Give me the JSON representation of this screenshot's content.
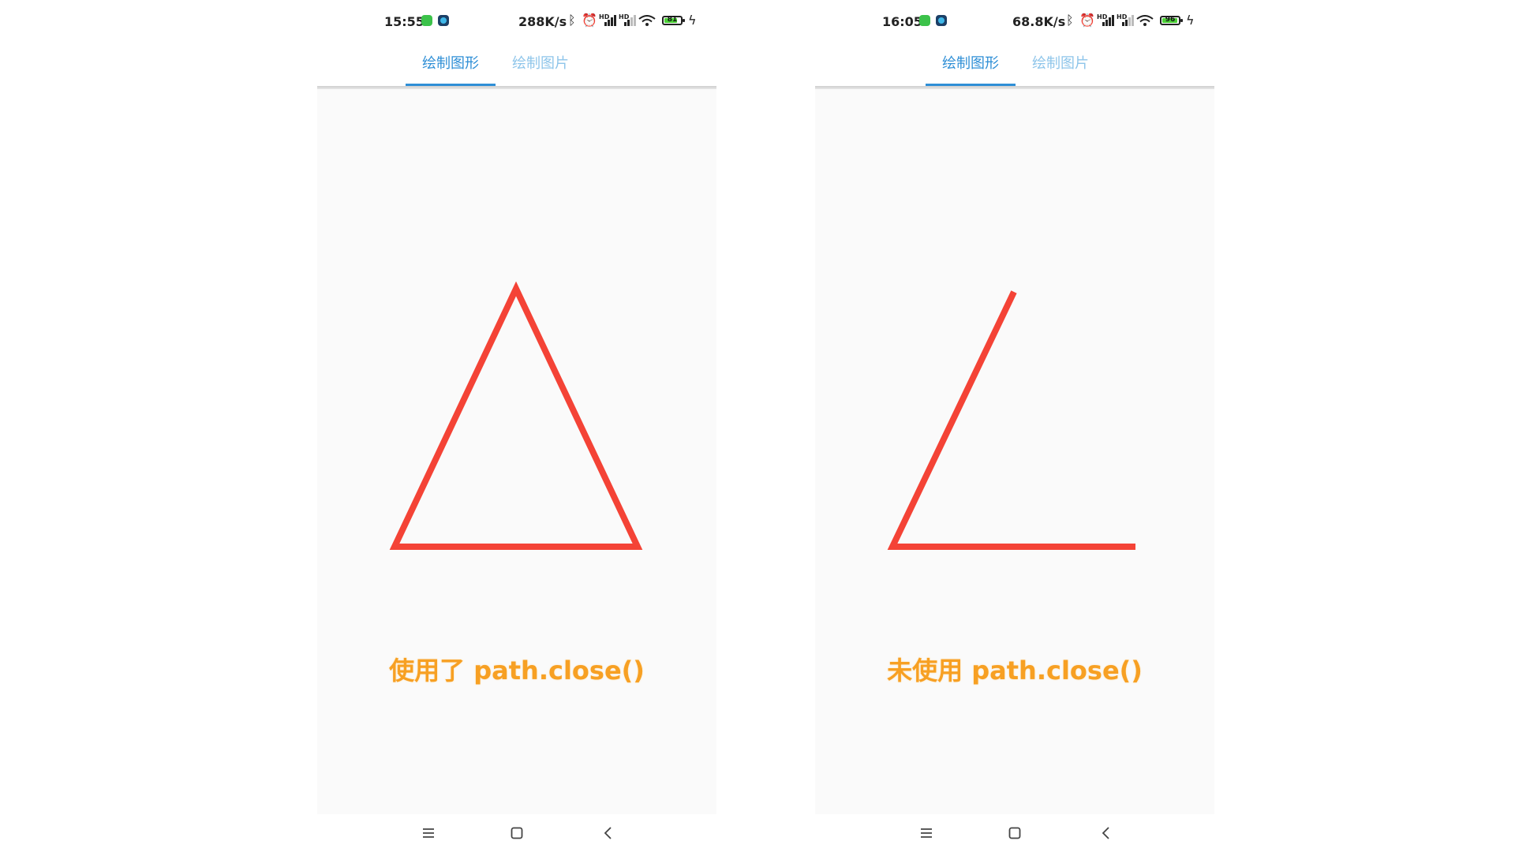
{
  "screens": [
    {
      "status": {
        "time": "15:55",
        "speed": "288K/s",
        "battery": "81",
        "battery_fraction": 0.81
      },
      "tabs": [
        {
          "label": "绘制图形",
          "active": true
        },
        {
          "label": "绘制图片",
          "active": false
        }
      ],
      "caption": "使用了 path.close()",
      "path_closed": true
    },
    {
      "status": {
        "time": "16:05",
        "speed": "68.8K/s",
        "battery": "96",
        "battery_fraction": 0.96
      },
      "tabs": [
        {
          "label": "绘制图形",
          "active": true
        },
        {
          "label": "绘制图片",
          "active": false
        }
      ],
      "caption": "未使用 path.close()",
      "path_closed": false
    }
  ],
  "colors": {
    "tab_active": "#2f8fd6",
    "tab_inactive": "#8ec5ea",
    "stroke": "#f44336",
    "caption": "#f7a023",
    "canvas_bg": "#fafafa"
  },
  "icons": {
    "status": [
      "notification-app-icon",
      "bluetooth-icon",
      "alarm-icon",
      "hd-signal-icon",
      "wifi-icon",
      "battery-icon",
      "charging-icon"
    ],
    "nav": [
      "menu-icon",
      "home-icon",
      "back-icon"
    ]
  }
}
